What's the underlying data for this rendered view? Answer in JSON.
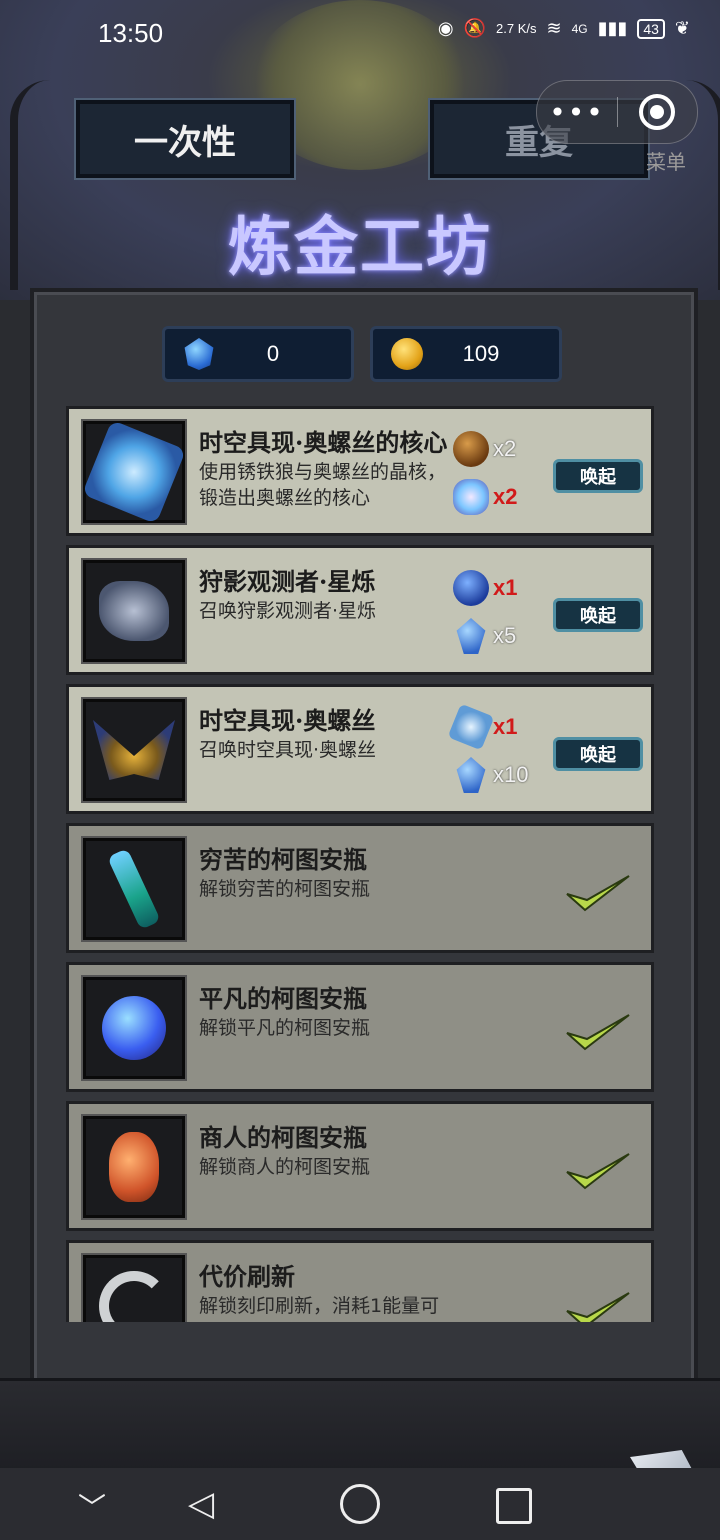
{
  "status_bar": {
    "time": "13:50",
    "net_speed": "2.7 K/s",
    "network": "4G",
    "battery": "43"
  },
  "header": {
    "tabs": [
      {
        "label": "一次性",
        "active": true
      },
      {
        "label": "重复",
        "active": false
      }
    ],
    "title": "炼金工坊",
    "capsule": {
      "more": "•••",
      "menu_hint": "菜单"
    }
  },
  "currencies": [
    {
      "icon": "blue-gem-icon",
      "value": "0"
    },
    {
      "icon": "gold-coin-icon",
      "value": "109"
    }
  ],
  "recipes": [
    {
      "title": "时空具现·奥螺丝的核心",
      "desc": "使用锈铁狼与奥螺丝的晶核，锻造出奥螺丝的核心",
      "icon": "star-core-icon",
      "costs": [
        {
          "icon": "rust-iron-icon",
          "qty": "x2",
          "insufficient": false
        },
        {
          "icon": "crystal-heart-icon",
          "qty": "x2",
          "insufficient": true
        }
      ],
      "action": "唤起",
      "completed": false
    },
    {
      "title": "狩影观测者·星烁",
      "desc": "召唤狩影观测者·星烁",
      "icon": "telescope-icon",
      "costs": [
        {
          "icon": "blue-sphere-icon",
          "qty": "x1",
          "insufficient": true
        },
        {
          "icon": "blue-crystal-icon",
          "qty": "x5",
          "insufficient": false
        }
      ],
      "action": "唤起",
      "completed": false
    },
    {
      "title": "时空具现·奥螺丝",
      "desc": "召唤时空具现·奥螺丝",
      "icon": "winged-relic-icon",
      "costs": [
        {
          "icon": "star-core-icon",
          "qty": "x1",
          "insufficient": true
        },
        {
          "icon": "blue-crystal-icon",
          "qty": "x10",
          "insufficient": false
        }
      ],
      "action": "唤起",
      "completed": false
    },
    {
      "title": "穷苦的柯图安瓶",
      "desc": "解锁穷苦的柯图安瓶",
      "icon": "slim-bottle-icon",
      "costs": [],
      "completed": true
    },
    {
      "title": "平凡的柯图安瓶",
      "desc": "解锁平凡的柯图安瓶",
      "icon": "round-flask-icon",
      "costs": [],
      "completed": true
    },
    {
      "title": "商人的柯图安瓶",
      "desc": "解锁商人的柯图安瓶",
      "icon": "vase-icon",
      "costs": [],
      "completed": true
    },
    {
      "title": "代价刷新",
      "desc": "解锁刻印刷新，消耗1能量可",
      "icon": "refresh-icon",
      "costs": [],
      "completed": true
    }
  ],
  "colors": {
    "title_glow": "#c9c8ff",
    "insufficient": "#d11a1a",
    "check": "#b8d84a"
  }
}
